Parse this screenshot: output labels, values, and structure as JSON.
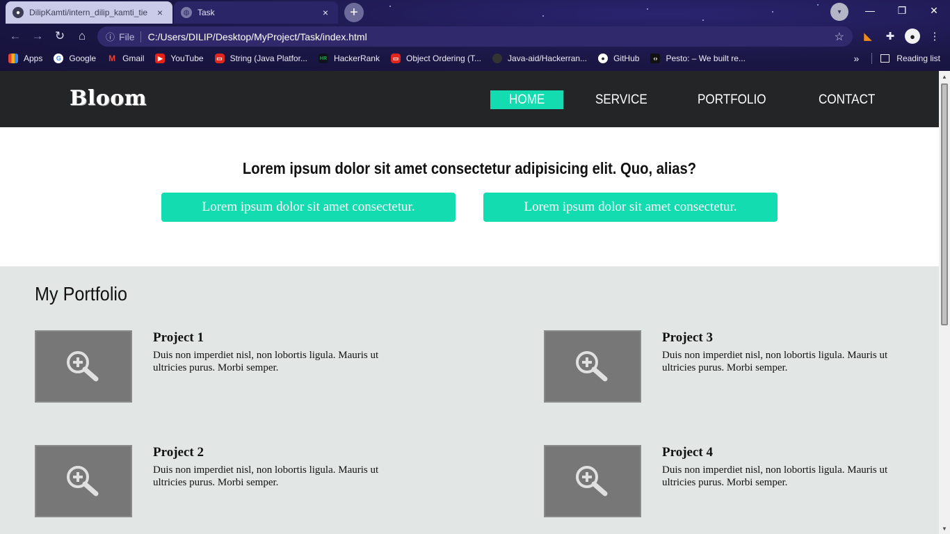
{
  "browser": {
    "tabs": [
      {
        "title": "DilipKamti/intern_dilip_kamti_tie",
        "close": "×"
      },
      {
        "title": "Task",
        "close": "×"
      }
    ],
    "new_tab": "+",
    "window_controls": {
      "minimize": "—",
      "restore": "❐",
      "close": "✕"
    },
    "nav": {
      "back": "←",
      "forward": "→",
      "reload": "↻",
      "home": "⌂"
    },
    "address": {
      "info": "ⓘ",
      "scheme": "File",
      "url": "C:/Users/DILIP/Desktop/MyProject/Task/index.html",
      "bookmark_star": "☆"
    },
    "bookmarks": [
      {
        "label": "Apps",
        "icon": "apps-grid-icon",
        "color": "#e8a33a"
      },
      {
        "label": "Google",
        "icon": "google-icon",
        "color": "#ffffff"
      },
      {
        "label": "Gmail",
        "icon": "gmail-icon",
        "color": "#ffffff"
      },
      {
        "label": "YouTube",
        "icon": "youtube-icon",
        "color": "#e62117"
      },
      {
        "label": "String (Java Platfor...",
        "icon": "oracle-icon",
        "color": "#e0261d"
      },
      {
        "label": "HackerRank",
        "icon": "hackerrank-icon",
        "color": "#1ba94c"
      },
      {
        "label": "Object Ordering (T...",
        "icon": "oracle-icon",
        "color": "#e0261d"
      },
      {
        "label": "Java-aid/Hackerran...",
        "icon": "github-icon",
        "color": "#333333"
      },
      {
        "label": "GitHub",
        "icon": "github-icon",
        "color": "#ffffff"
      },
      {
        "label": "Pesto: – We built re...",
        "icon": "pesto-icon",
        "color": "#333333"
      }
    ],
    "bookmarks_more": "»",
    "reading_list": "Reading list"
  },
  "site": {
    "logo": "Bloom",
    "nav": {
      "home": "HOME",
      "service": "SERVICE",
      "portfolio": "PORTFOLIO",
      "contact": "CONTACT"
    },
    "accent_color": "#13dcb0",
    "hero": {
      "headline": "Lorem ipsum dolor sit amet consectetur adipisicing elit. Quo, alias?",
      "button_1": "Lorem ipsum dolor sit amet consectetur.",
      "button_2": "Lorem ipsum dolor sit amet consectetur."
    },
    "portfolio": {
      "heading": "My Portfolio",
      "projects": [
        {
          "title": "Project 1",
          "desc": "Duis non imperdiet nisl, non lobortis ligula. Mauris ut ultricies purus. Morbi semper.",
          "icon": "zoom-in-icon"
        },
        {
          "title": "Project 2",
          "desc": "Duis non imperdiet nisl, non lobortis ligula. Mauris ut ultricies purus. Morbi semper.",
          "icon": "zoom-in-icon"
        },
        {
          "title": "Project 3",
          "desc": "Duis non imperdiet nisl, non lobortis ligula. Mauris ut ultricies purus. Morbi semper.",
          "icon": "zoom-in-icon"
        },
        {
          "title": "Project 4",
          "desc": "Duis non imperdiet nisl, non lobortis ligula. Mauris ut ultricies purus. Morbi semper.",
          "icon": "zoom-in-icon"
        }
      ]
    }
  }
}
